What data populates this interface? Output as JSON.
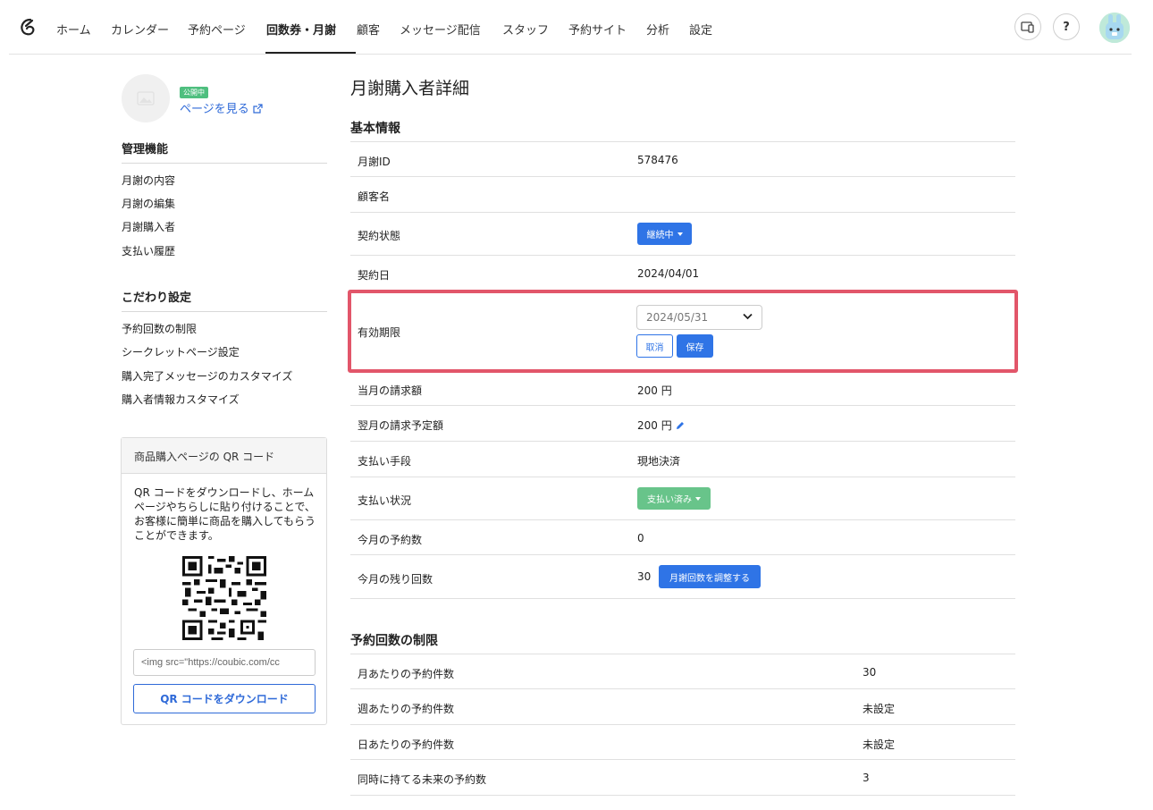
{
  "nav": {
    "items": [
      "ホーム",
      "カレンダー",
      "予約ページ",
      "回数券・月謝",
      "顧客",
      "メッセージ配信",
      "スタッフ",
      "予約サイト",
      "分析",
      "設定"
    ],
    "help_label": "?"
  },
  "sidebar": {
    "status_badge": "公開中",
    "view_page_link": "ページを見る",
    "management_heading": "管理機能",
    "management_items": [
      "月謝の内容",
      "月謝の編集",
      "月謝購入者",
      "支払い履歴"
    ],
    "custom_heading": "こだわり設定",
    "custom_items": [
      "予約回数の制限",
      "シークレットページ設定",
      "購入完了メッセージのカスタマイズ",
      "購入者情報カスタマイズ"
    ],
    "qr": {
      "heading": "商品購入ページの QR コード",
      "description": "QR コードをダウンロードし、ホームページやちらしに貼り付けることで、お客様に簡単に商品を購入してもらうことができます。",
      "embed_code": "<img src=\"https://coubic.com/cc",
      "download_button": "QR コードをダウンロード"
    }
  },
  "main": {
    "title": "月謝購入者詳細",
    "basic_heading": "基本情報",
    "rows": {
      "id_label": "月謝ID",
      "id_value": "578476",
      "customer_label": "顧客名",
      "customer_value": "",
      "status_label": "契約状態",
      "status_button": "継続中",
      "contract_date_label": "契約日",
      "contract_date_value": "2024/04/01",
      "expiry_label": "有効期限",
      "expiry_value": "2024/05/31",
      "cancel_button": "取消",
      "save_button": "保存",
      "current_bill_label": "当月の請求額",
      "current_bill_value": "200 円",
      "next_bill_label": "翌月の請求予定額",
      "next_bill_value": "200 円",
      "payment_method_label": "支払い手段",
      "payment_method_value": "現地決済",
      "payment_status_label": "支払い状況",
      "payment_status_button": "支払い済み",
      "month_bookings_label": "今月の予約数",
      "month_bookings_value": "0",
      "remaining_label": "今月の残り回数",
      "remaining_value": "30",
      "adjust_button": "月謝回数を調整する"
    },
    "limits_heading": "予約回数の制限",
    "limits": [
      {
        "label": "月あたりの予約件数",
        "value": "30"
      },
      {
        "label": "週あたりの予約件数",
        "value": "未設定"
      },
      {
        "label": "日あたりの予約件数",
        "value": "未設定"
      },
      {
        "label": "同時に持てる未来の予約数",
        "value": "3"
      }
    ]
  },
  "colors": {
    "primary": "#2f74e6",
    "success": "#68c48a",
    "highlight": "#e2566a",
    "badge": "#4fbf7f"
  }
}
